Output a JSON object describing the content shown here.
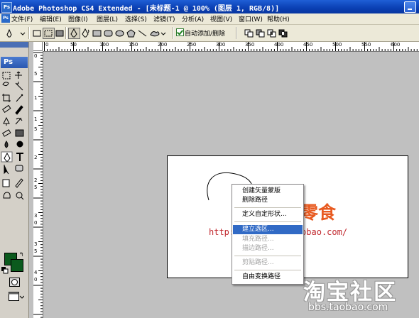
{
  "window": {
    "title": "Adobe Photoshop CS4 Extended - [未标题-1 @ 100% (图层 1, RGB/8)]"
  },
  "menu": [
    {
      "label": "文件(F)"
    },
    {
      "label": "编辑(E)"
    },
    {
      "label": "图像(I)"
    },
    {
      "label": "图层(L)"
    },
    {
      "label": "选择(S)"
    },
    {
      "label": "滤镜(T)"
    },
    {
      "label": "分析(A)"
    },
    {
      "label": "视图(V)"
    },
    {
      "label": "窗口(W)"
    },
    {
      "label": "帮助(H)"
    }
  ],
  "options": {
    "auto_add_delete_checked": true,
    "auto_add_delete_label": "自动添加/删除"
  },
  "toolbox": {
    "logo": "Ps",
    "foreground_color": "#0b5a1d",
    "background_color": "#0b5a1d"
  },
  "rulers": {
    "h_labels": [
      "0",
      "50",
      "100",
      "150",
      "200",
      "250",
      "300",
      "350",
      "400",
      "450",
      "500",
      "550",
      "600"
    ],
    "v_labels": [
      "0",
      "5",
      "1",
      "1",
      "5",
      "2",
      "2",
      "5",
      "3",
      "0",
      "3",
      "5",
      "4",
      "0"
    ]
  },
  "document": {
    "brand_text": "零食",
    "tagline": "http://www.xxxx.taobao.com/"
  },
  "context_menu": {
    "items": [
      {
        "label": "创建矢量蒙版",
        "state": "enabled"
      },
      {
        "label": "删除路径",
        "state": "enabled"
      },
      {
        "separator": true
      },
      {
        "label": "定义自定形状...",
        "state": "enabled"
      },
      {
        "separator": true
      },
      {
        "label": "建立选区...",
        "state": "highlighted"
      },
      {
        "label": "填充路径...",
        "state": "disabled"
      },
      {
        "label": "描边路径...",
        "state": "disabled"
      },
      {
        "separator": true
      },
      {
        "label": "剪贴路径...",
        "state": "disabled"
      },
      {
        "separator": true
      },
      {
        "label": "自由变换路径",
        "state": "enabled"
      }
    ]
  },
  "watermark": {
    "line1": "淘宝社区",
    "line2": "bbs.taobao.com"
  },
  "colors": {
    "titlebar": "#0a3fb3",
    "menu_highlight": "#316ac5",
    "brand": "#e85a20",
    "tagline": "#c1282e"
  }
}
